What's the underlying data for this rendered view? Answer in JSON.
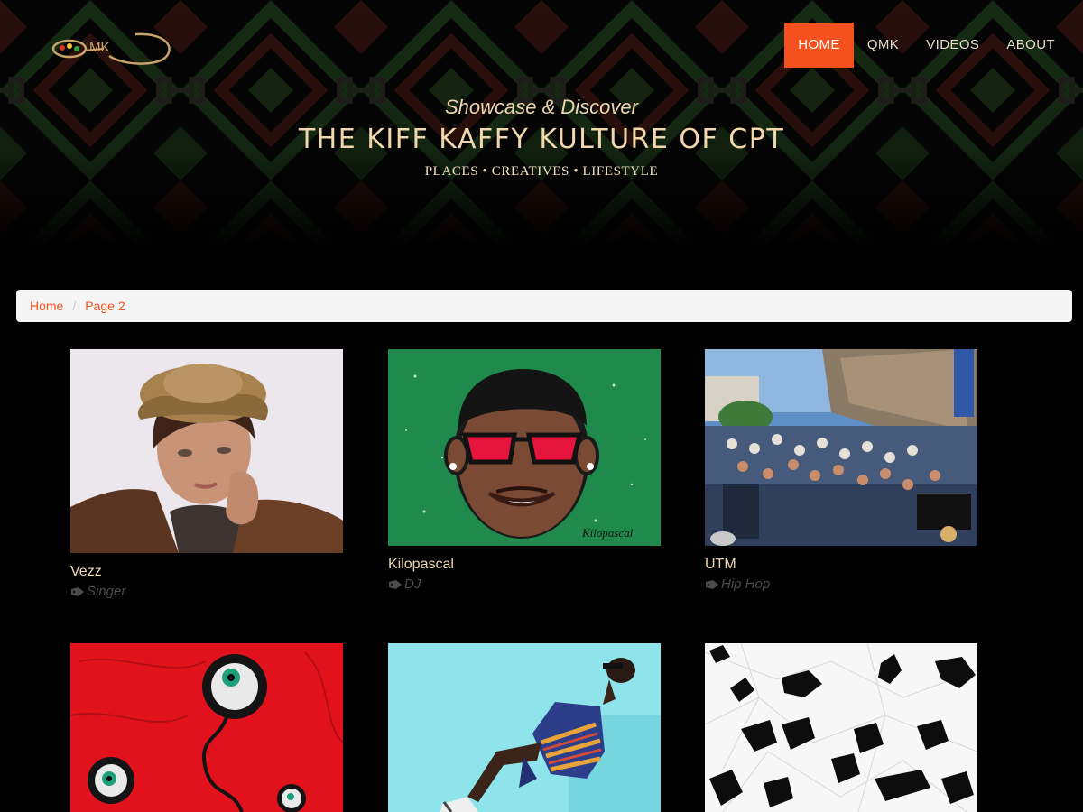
{
  "brand": {
    "logo_text": "QMK"
  },
  "nav": {
    "items": [
      {
        "label": "HOME",
        "active": true
      },
      {
        "label": "QMK",
        "active": false
      },
      {
        "label": "VIDEOS",
        "active": false
      },
      {
        "label": "ABOUT",
        "active": false
      }
    ]
  },
  "hero": {
    "tagline": "Showcase & Discover",
    "title": "THE KIFF KAFFY KULTURE OF CPT",
    "subtitle": "PLACES • CREATIVES • LIFESTYLE"
  },
  "breadcrumb": {
    "items": [
      "Home",
      "Page 2"
    ],
    "separator": "/"
  },
  "cards": [
    {
      "title": "Vezz",
      "tag": "Singer",
      "image": "portrait-man-hat"
    },
    {
      "title": "Kilopascal",
      "tag": "DJ",
      "image": "cartoon-face-red-glasses",
      "signature": "Kilopascal"
    },
    {
      "title": "UTM",
      "tag": "Hip Hop",
      "image": "outdoor-crowd-event"
    },
    {
      "title": "",
      "tag": "",
      "image": "red-eyeball-art"
    },
    {
      "title": "",
      "tag": "",
      "image": "man-reclining-blue-wall"
    },
    {
      "title": "",
      "tag": "",
      "image": "black-white-lowpoly-shapes"
    }
  ],
  "colors": {
    "accent": "#f4511e",
    "title_cream": "#f0d7ae",
    "tag_gray": "#4b4b4b",
    "breadcrumb_bg": "#f5f5f5"
  }
}
